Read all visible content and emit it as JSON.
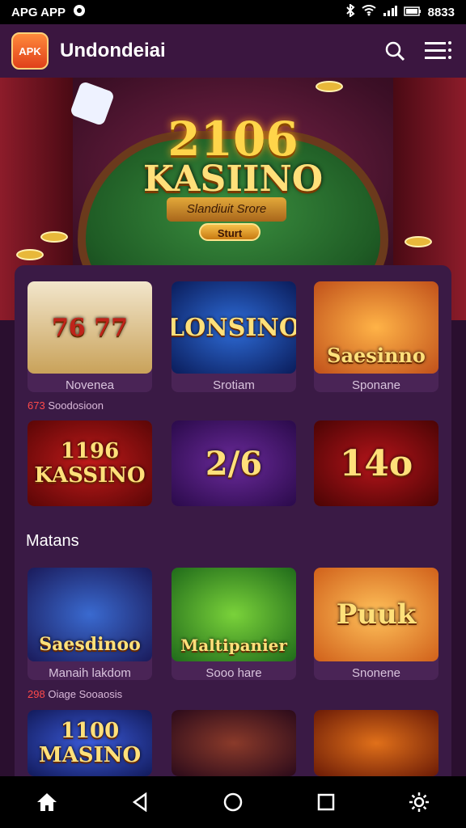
{
  "status_bar": {
    "left_text": "APG APP",
    "right_text": "8833"
  },
  "app_bar": {
    "logo_text": "APK",
    "title": "Undondeiai"
  },
  "hero": {
    "number": "2106",
    "title": "KASIINO",
    "subtitle": "Slandiuit Srore",
    "button": "Sturt"
  },
  "grid1": [
    {
      "art": "76 77",
      "label": "Novenea"
    },
    {
      "art": "LONSINO",
      "label": "Srotiam"
    },
    {
      "art": "Saesinno",
      "label": "Sponane"
    }
  ],
  "grid1_note": {
    "highlight": "673",
    "text": "Soodosioon"
  },
  "grid2": [
    {
      "art": "1196 KASSINO"
    },
    {
      "art": "2/6"
    },
    {
      "art": "14o"
    }
  ],
  "section_title": "Matans",
  "grid3": [
    {
      "art": "Saesdinoo",
      "label": "Manaih lakdom"
    },
    {
      "art": "Maltipanier",
      "label": "Sooo hare"
    },
    {
      "art": "Puuk",
      "label": "Snonene"
    }
  ],
  "grid3_note": {
    "highlight": "298",
    "text": "Oiage Sooaosis"
  },
  "grid4": [
    {
      "art": "1100 MASINO"
    },
    {
      "art": ""
    },
    {
      "art": ""
    }
  ],
  "colors": {
    "accent": "#ffd54a",
    "background": "#2a0f2f",
    "panel": "#3a1a45"
  }
}
